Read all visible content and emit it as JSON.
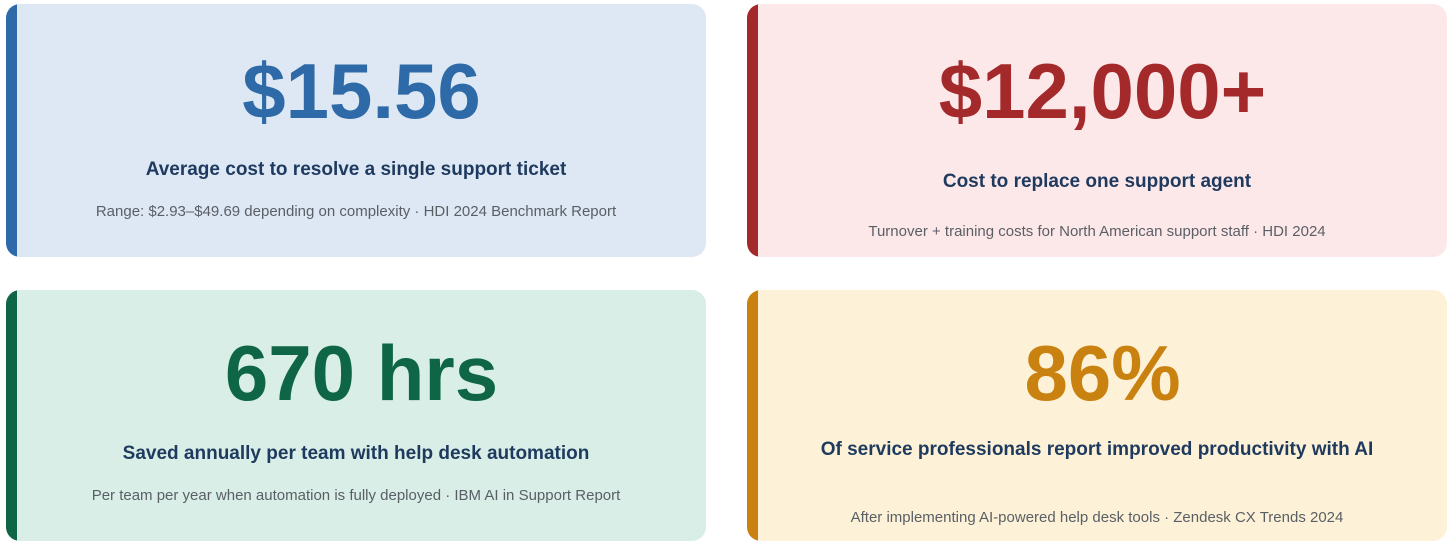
{
  "cards": [
    {
      "value": "$15.56",
      "label": "Average cost to resolve a single support ticket",
      "note": "Range: $2.93–$49.69 depending on complexity · HDI 2024 Benchmark Report",
      "accent_color": "#2e6aa7",
      "background_color": "#dde8f4"
    },
    {
      "value": "$12,000+",
      "label": "Cost to replace one support agent",
      "note": "Turnover + training costs for North American support staff · HDI 2024",
      "accent_color": "#a3292b",
      "background_color": "#fde8e9"
    },
    {
      "value": "670 hrs",
      "label": "Saved annually per team with help desk automation",
      "note": "Per team per year when automation is fully deployed · IBM AI in Support Report",
      "accent_color": "#0e6647",
      "background_color": "#d8eee6"
    },
    {
      "value": "86%",
      "label": "Of service professionals report improved productivity with AI",
      "note": "After implementing AI-powered help desk tools · Zendesk CX Trends 2024",
      "accent_color": "#c98210",
      "background_color": "#fdf2d7"
    }
  ]
}
